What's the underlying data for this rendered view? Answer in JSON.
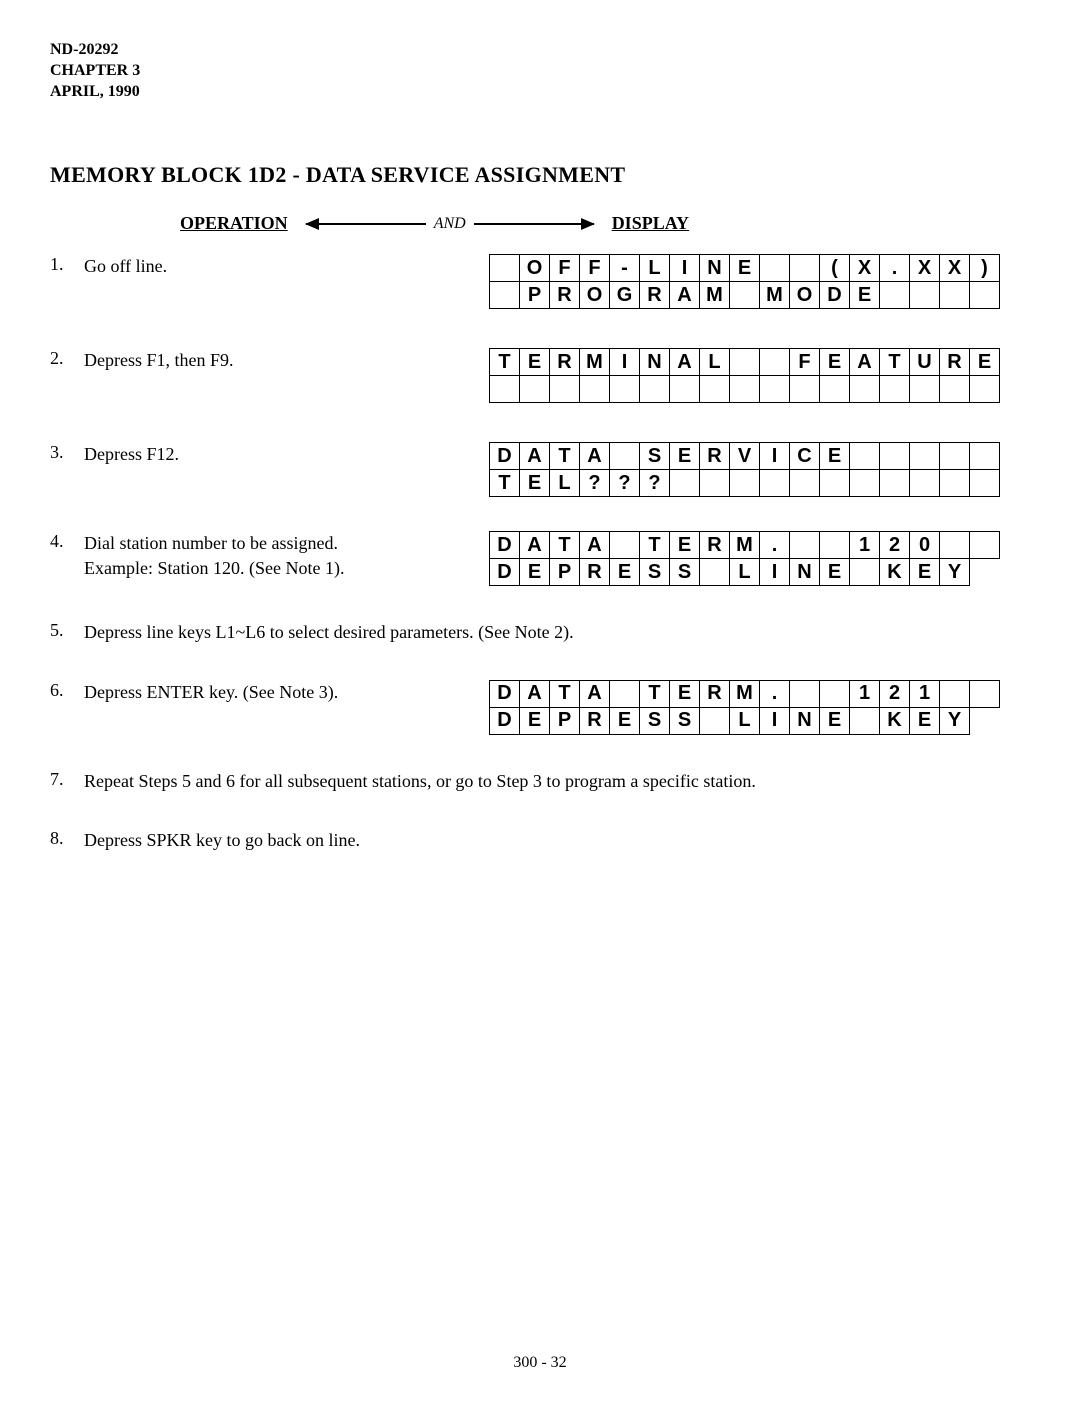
{
  "header": {
    "doc": "ND-20292",
    "chapter": "CHAPTER 3",
    "date": "APRIL, 1990"
  },
  "title": "MEMORY BLOCK 1D2 - DATA SERVICE ASSIGNMENT",
  "labels": {
    "operation": "OPERATION",
    "and": "AND",
    "display": "DISPLAY"
  },
  "steps": {
    "s1": {
      "text": "Go off line.",
      "g": [
        [
          " ",
          "O",
          "F",
          "F",
          "-",
          "L",
          "I",
          "N",
          "E",
          " ",
          " ",
          "(",
          "X",
          ".",
          "X",
          "X",
          ")"
        ],
        [
          " ",
          "P",
          "R",
          "O",
          "G",
          "R",
          "A",
          "M",
          " ",
          "M",
          "O",
          "D",
          "E",
          " ",
          " ",
          " ",
          " "
        ]
      ]
    },
    "s2": {
      "text": "Depress F1, then F9.",
      "g": [
        [
          "T",
          "E",
          "R",
          "M",
          "I",
          "N",
          "A",
          "L",
          " ",
          " ",
          "F",
          "E",
          "A",
          "T",
          "U",
          "R",
          "E"
        ],
        [
          " ",
          " ",
          " ",
          " ",
          " ",
          " ",
          " ",
          " ",
          " ",
          " ",
          " ",
          " ",
          " ",
          " ",
          " ",
          " ",
          " "
        ]
      ]
    },
    "s3": {
      "text": "Depress F12.",
      "g": [
        [
          "D",
          "A",
          "T",
          "A",
          " ",
          "S",
          "E",
          "R",
          "V",
          "I",
          "C",
          "E",
          " ",
          " ",
          " ",
          " ",
          " "
        ],
        [
          "T",
          "E",
          "L",
          "?",
          "?",
          "?",
          " ",
          " ",
          " ",
          " ",
          " ",
          " ",
          " ",
          " ",
          " ",
          " ",
          " "
        ]
      ]
    },
    "s4": {
      "text1": "Dial station number to be assigned.",
      "text2": "Example: Station 120.  (See Note 1).",
      "g": [
        [
          "D",
          "A",
          "T",
          "A",
          " ",
          "T",
          "E",
          "R",
          "M",
          ".",
          " ",
          " ",
          "1",
          "2",
          "0",
          " ",
          " "
        ],
        [
          "D",
          "E",
          "P",
          "R",
          "E",
          "S",
          "S",
          " ",
          "L",
          "I",
          "N",
          "E",
          " ",
          "K",
          "E",
          "Y"
        ]
      ]
    },
    "s5": {
      "text": "Depress line keys L1~L6 to select desired parameters.  (See Note 2)."
    },
    "s6": {
      "text": "Depress ENTER key.  (See Note 3).",
      "g": [
        [
          "D",
          "A",
          "T",
          "A",
          " ",
          "T",
          "E",
          "R",
          "M",
          ".",
          " ",
          " ",
          "1",
          "2",
          "1",
          " ",
          " "
        ],
        [
          "D",
          "E",
          "P",
          "R",
          "E",
          "S",
          "S",
          " ",
          "L",
          "I",
          "N",
          "E",
          " ",
          "K",
          "E",
          "Y"
        ]
      ]
    },
    "s7": {
      "text": "Repeat Steps 5 and 6 for all subsequent stations, or go to Step 3 to program a specific station."
    },
    "s8": {
      "text": "Depress SPKR key to go back on line."
    }
  },
  "footer": "300 - 32"
}
